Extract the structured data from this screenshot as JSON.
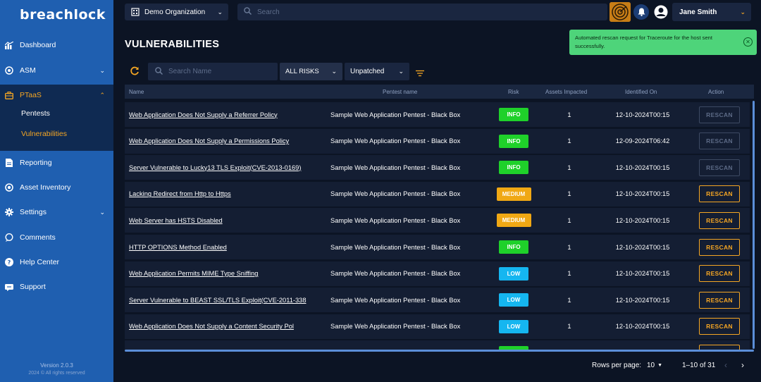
{
  "app": {
    "logo_text": "breachlock"
  },
  "sidebar": {
    "items": [
      {
        "label": "Dashboard",
        "icon": "chart-icon"
      },
      {
        "label": "ASM",
        "icon": "target-icon"
      },
      {
        "label": "PTaaS",
        "icon": "briefcase-icon"
      },
      {
        "label": "Reporting",
        "icon": "document-icon"
      },
      {
        "label": "Asset Inventory",
        "icon": "inventory-icon"
      },
      {
        "label": "Settings",
        "icon": "gear-icon"
      },
      {
        "label": "Comments",
        "icon": "comment-icon"
      },
      {
        "label": "Help Center",
        "icon": "help-icon"
      },
      {
        "label": "Support",
        "icon": "support-icon"
      }
    ],
    "ptaas_sub": [
      {
        "label": "Pentests",
        "active": false
      },
      {
        "label": "Vulnerabilities",
        "active": true
      }
    ],
    "version": "Version 2.0.3",
    "copyright": "2024 © All rights reserved"
  },
  "topbar": {
    "organization": "Demo Organization",
    "search_placeholder": "Search",
    "user_name": "Jane Smith"
  },
  "toast": {
    "message": "Automated rescan request for Traceroute for the host sent successfully."
  },
  "main": {
    "title": "VULNERABILITIES",
    "search_placeholder": "Search Name",
    "risk_filter": "ALL RISKS",
    "patch_filter": "Unpatched"
  },
  "table": {
    "headers": {
      "name": "Name",
      "pentest": "Pentest name",
      "risk": "Risk",
      "assets": "Assets Impacted",
      "identified": "Identified On",
      "action": "Action"
    },
    "rows": [
      {
        "name": "Web Application Does Not Supply a Referrer Policy",
        "pentest": "Sample Web Application Pentest - Black Box",
        "risk": "INFO",
        "assets": "1",
        "identified": "12-10-2024T00:15",
        "action": "RESCAN",
        "enabled": false
      },
      {
        "name": "Web Application Does Not Supply a Permissions Policy",
        "pentest": "Sample Web Application Pentest - Black Box",
        "risk": "INFO",
        "assets": "1",
        "identified": "12-09-2024T06:42",
        "action": "RESCAN",
        "enabled": false
      },
      {
        "name": "Server Vulnerable to Lucky13 TLS Exploit(CVE-2013-0169)",
        "pentest": "Sample Web Application Pentest - Black Box",
        "risk": "INFO",
        "assets": "1",
        "identified": "12-10-2024T00:15",
        "action": "RESCAN",
        "enabled": false
      },
      {
        "name": "Lacking Redirect from Http to Https",
        "pentest": "Sample Web Application Pentest - Black Box",
        "risk": "MEDIUM",
        "assets": "1",
        "identified": "12-10-2024T00:15",
        "action": "RESCAN",
        "enabled": true
      },
      {
        "name": "Web Server has HSTS Disabled",
        "pentest": "Sample Web Application Pentest - Black Box",
        "risk": "MEDIUM",
        "assets": "1",
        "identified": "12-10-2024T00:15",
        "action": "RESCAN",
        "enabled": true
      },
      {
        "name": "HTTP OPTIONS Method Enabled",
        "pentest": "Sample Web Application Pentest - Black Box",
        "risk": "INFO",
        "assets": "1",
        "identified": "12-10-2024T00:15",
        "action": "RESCAN",
        "enabled": true
      },
      {
        "name": "Web Application Permits MIME Type Sniffing",
        "pentest": "Sample Web Application Pentest - Black Box",
        "risk": "LOW",
        "assets": "1",
        "identified": "12-10-2024T00:15",
        "action": "RESCAN",
        "enabled": true
      },
      {
        "name": "Server Vulnerable to BEAST SSL/TLS Exploit(CVE-2011-338",
        "pentest": "Sample Web Application Pentest - Black Box",
        "risk": "LOW",
        "assets": "1",
        "identified": "12-10-2024T00:15",
        "action": "RESCAN",
        "enabled": true
      },
      {
        "name": "Web Application Does Not Supply a Content Security Pol",
        "pentest": "Sample Web Application Pentest - Black Box",
        "risk": "LOW",
        "assets": "1",
        "identified": "12-10-2024T00:15",
        "action": "RESCAN",
        "enabled": true
      },
      {
        "name": "",
        "pentest": "",
        "risk": "INFO",
        "assets": "",
        "identified": "",
        "action": "",
        "enabled": true
      }
    ]
  },
  "pagination": {
    "rows_label": "Rows per page:",
    "rows_value": "10",
    "range": "1–10 of 31"
  },
  "colors": {
    "sidebar": "#1f5fb0",
    "accent": "#f5a623",
    "info": "#1fd12a",
    "medium": "#f0a814",
    "low": "#15b6f0",
    "toast": "#4ed47a"
  }
}
